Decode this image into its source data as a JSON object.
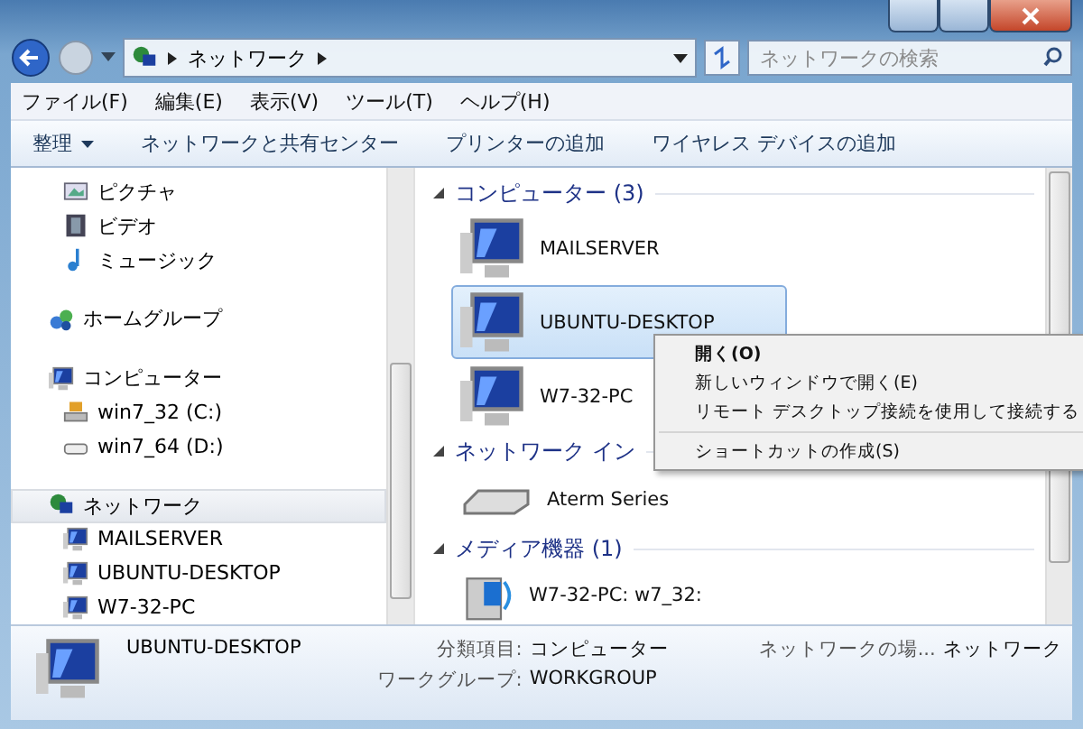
{
  "address_bar": {
    "path": [
      "ネットワーク"
    ]
  },
  "search": {
    "placeholder": "ネットワークの検索"
  },
  "menu_bar": [
    "ファイル(F)",
    "編集(E)",
    "表示(V)",
    "ツール(T)",
    "ヘルプ(H)"
  ],
  "command_bar": [
    {
      "label": "整理",
      "dropdown": true
    },
    {
      "label": "ネットワークと共有センター",
      "dropdown": false
    },
    {
      "label": "プリンターの追加",
      "dropdown": false
    },
    {
      "label": "ワイヤレス デバイスの追加",
      "dropdown": false
    }
  ],
  "navigation": [
    {
      "label": "ピクチャ",
      "kind": "pictures",
      "selected": false
    },
    {
      "label": "ビデオ",
      "kind": "videos",
      "selected": false
    },
    {
      "label": "ミュージック",
      "kind": "music",
      "selected": false
    },
    {
      "label": "ホームグループ",
      "kind": "homegroup",
      "selected": false
    },
    {
      "label": "コンピューター",
      "kind": "computer",
      "selected": false,
      "children": [
        {
          "label": "win7_32 (C:)",
          "kind": "system-drive"
        },
        {
          "label": "win7_64 (D:)",
          "kind": "drive"
        }
      ]
    },
    {
      "label": "ネットワーク",
      "kind": "network",
      "selected": true,
      "children": [
        {
          "label": "MAILSERVER",
          "kind": "computer"
        },
        {
          "label": "UBUNTU-DESKTOP",
          "kind": "computer"
        },
        {
          "label": "W7-32-PC",
          "kind": "computer"
        }
      ]
    }
  ],
  "groups": [
    {
      "title": "コンピューター (3)",
      "items": [
        {
          "label": "MAILSERVER",
          "kind": "computer",
          "selected": false
        },
        {
          "label": "UBUNTU-DESKTOP",
          "kind": "computer",
          "selected": true
        },
        {
          "label": "W7-32-PC",
          "kind": "computer",
          "selected": false
        }
      ]
    },
    {
      "title": "ネットワーク イン",
      "items": [
        {
          "label": "Aterm Series",
          "kind": "router",
          "selected": false
        }
      ]
    },
    {
      "title": "メディア機器 (1)",
      "items": [
        {
          "label": "W7-32-PC: w7_32:",
          "kind": "media",
          "selected": false
        }
      ]
    }
  ],
  "context_menu": [
    {
      "label": "開く(O)",
      "default": true,
      "separator_before": false
    },
    {
      "label": "新しいウィンドウで開く(E)",
      "default": false,
      "separator_before": false
    },
    {
      "label": "リモート デスクトップ接続を使用して接続する",
      "default": false,
      "separator_before": false
    },
    {
      "label": "ショートカットの作成(S)",
      "default": false,
      "separator_before": true
    }
  ],
  "details": {
    "name": "UBUNTU-DESKTOP",
    "fields": [
      {
        "label": "分類項目:",
        "value": "コンピューター"
      },
      {
        "label": "ワークグループ:",
        "value": "WORKGROUP"
      }
    ],
    "extra": {
      "label": "ネットワークの場...",
      "value": "ネットワーク"
    }
  }
}
